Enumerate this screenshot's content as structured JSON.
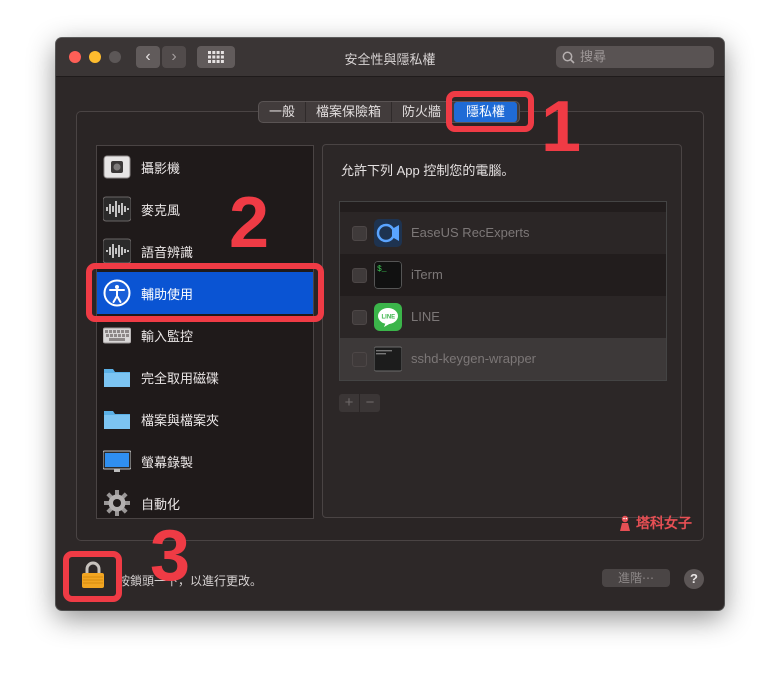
{
  "window": {
    "title": "安全性與隱私權",
    "search_placeholder": "搜尋",
    "nav_back": "‹",
    "nav_forward": "›"
  },
  "tabs": [
    {
      "label": "一般",
      "selected": false
    },
    {
      "label": "檔案保險箱",
      "selected": false
    },
    {
      "label": "防火牆",
      "selected": false
    },
    {
      "label": "隱私權",
      "selected": true
    }
  ],
  "sidebar": {
    "items": [
      {
        "label": "攝影機",
        "icon": "camera-icon"
      },
      {
        "label": "麥克風",
        "icon": "microphone-icon"
      },
      {
        "label": "語音辨識",
        "icon": "speech-recognition-icon"
      },
      {
        "label": "輔助使用",
        "icon": "accessibility-icon",
        "selected": true
      },
      {
        "label": "輸入監控",
        "icon": "keyboard-icon"
      },
      {
        "label": "完全取用磁碟",
        "icon": "folder-icon"
      },
      {
        "label": "檔案與檔案夾",
        "icon": "folder-icon"
      },
      {
        "label": "螢幕錄製",
        "icon": "display-icon"
      },
      {
        "label": "自動化",
        "icon": "gear-icon"
      }
    ]
  },
  "main": {
    "heading": "允許下列 App 控制您的電腦。",
    "apps": [
      {
        "name": "EaseUS RecExperts",
        "icon": "easeus-icon",
        "checked": false
      },
      {
        "name": "iTerm",
        "icon": "terminal-icon",
        "checked": false
      },
      {
        "name": "LINE",
        "icon": "line-icon",
        "checked": false
      },
      {
        "name": "sshd-keygen-wrapper",
        "icon": "executable-icon",
        "checked": false
      }
    ],
    "add_label": "+",
    "remove_label": "−"
  },
  "footer": {
    "lock_text": "按鎖頭一下，以進行更改。",
    "advanced_label": "進階⋯",
    "help_label": "?"
  },
  "watermark": "塔科女子",
  "annotations": {
    "step1": "1",
    "step2": "2",
    "step3": "3",
    "color": "#ef3b45"
  },
  "colors": {
    "accent": "#0a54d3",
    "tab_selected": "#1f6bd6",
    "window_bg": "#2d2828"
  }
}
